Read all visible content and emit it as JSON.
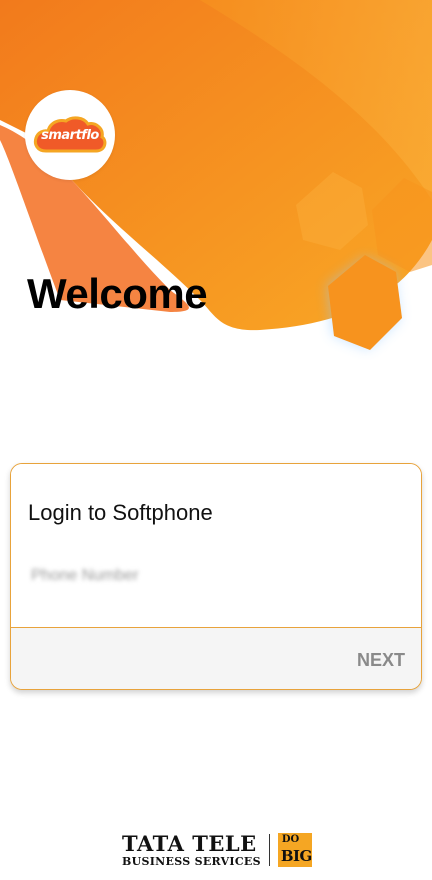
{
  "app": {
    "logo_text": "smartflo",
    "welcome_title": "Welcome"
  },
  "login_card": {
    "title": "Login to Softphone",
    "input_placeholder": "Phone Number",
    "next_label": "NEXT"
  },
  "footer": {
    "brand_line1": "TATA TELE",
    "brand_line2": "BUSINESS SERVICES",
    "badge_line1": "DO",
    "badge_line2": "BIG"
  },
  "colors": {
    "brand_orange": "#f59a23",
    "card_border": "#e8a33b",
    "next_text": "#8a8a8a"
  }
}
